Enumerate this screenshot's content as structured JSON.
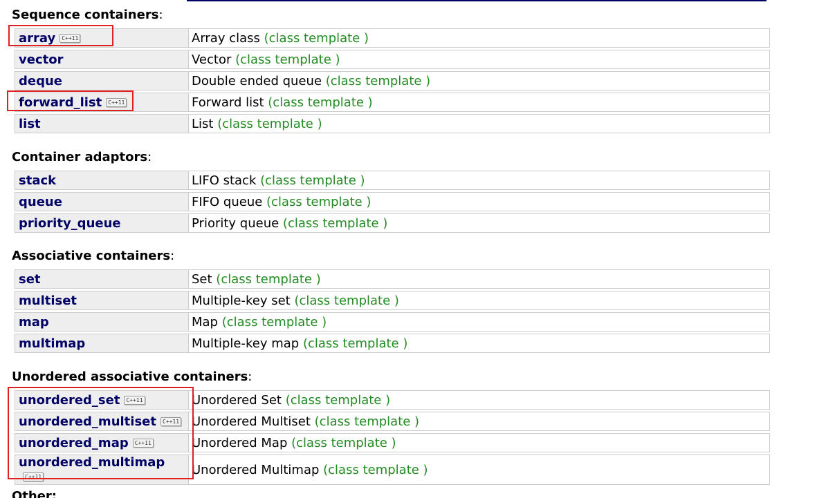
{
  "sections": [
    {
      "title": "Sequence containers",
      "rows": [
        {
          "name": "array",
          "desc": "Array class",
          "tag": "(class template )",
          "badge": "C++11"
        },
        {
          "name": "vector",
          "desc": "Vector",
          "tag": "(class template )",
          "badge": ""
        },
        {
          "name": "deque",
          "desc": "Double ended queue",
          "tag": "(class template )",
          "badge": ""
        },
        {
          "name": "forward_list",
          "desc": "Forward list",
          "tag": "(class template )",
          "badge": "C++11"
        },
        {
          "name": "list",
          "desc": "List",
          "tag": "(class template )",
          "badge": ""
        }
      ]
    },
    {
      "title": "Container adaptors",
      "rows": [
        {
          "name": "stack",
          "desc": "LIFO stack",
          "tag": "(class template )",
          "badge": ""
        },
        {
          "name": "queue",
          "desc": "FIFO queue",
          "tag": "(class template )",
          "badge": ""
        },
        {
          "name": "priority_queue",
          "desc": "Priority queue",
          "tag": "(class template )",
          "badge": ""
        }
      ]
    },
    {
      "title": "Associative containers",
      "rows": [
        {
          "name": "set",
          "desc": "Set",
          "tag": "(class template )",
          "badge": ""
        },
        {
          "name": "multiset",
          "desc": "Multiple-key set",
          "tag": "(class template )",
          "badge": ""
        },
        {
          "name": "map",
          "desc": "Map",
          "tag": "(class template )",
          "badge": ""
        },
        {
          "name": "multimap",
          "desc": "Multiple-key map",
          "tag": "(class template )",
          "badge": ""
        }
      ]
    },
    {
      "title": "Unordered associative containers",
      "rows": [
        {
          "name": "unordered_set",
          "desc": "Unordered Set",
          "tag": "(class template )",
          "badge": "C++11"
        },
        {
          "name": "unordered_multiset",
          "desc": "Unordered Multiset",
          "tag": "(class template )",
          "badge": "C++11"
        },
        {
          "name": "unordered_map",
          "desc": "Unordered Map",
          "tag": "(class template )",
          "badge": "C++11"
        },
        {
          "name": "unordered_multimap",
          "desc": "Unordered Multimap",
          "tag": "(class template )",
          "badge": "C++11"
        }
      ]
    }
  ],
  "other_heading": "Other:",
  "colors": {
    "link": "#000066",
    "template": "#228b22",
    "highlight": "#e02020"
  }
}
